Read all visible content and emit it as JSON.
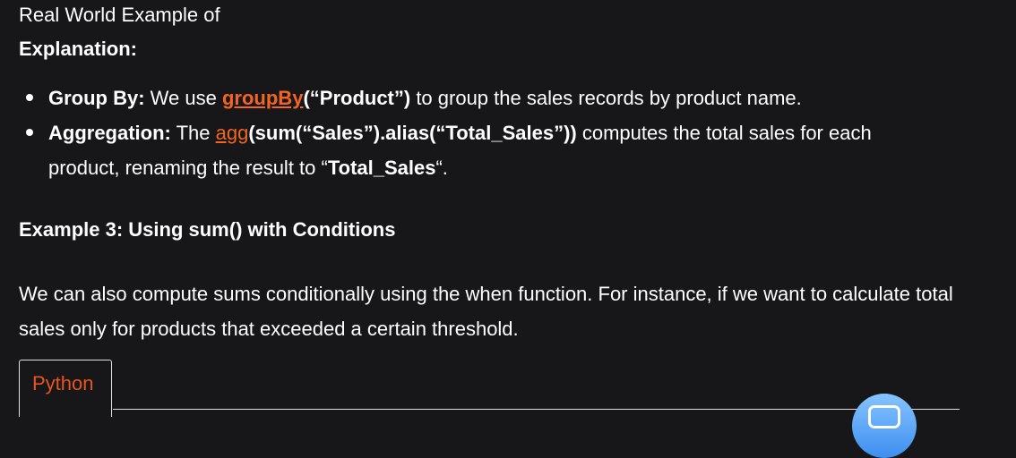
{
  "intro_line": "Real World Example of",
  "explanation_heading": "Explanation:",
  "bullets": [
    {
      "label": "Group By:",
      "text1": " We use ",
      "link": "groupBy",
      "code": "(“Product”)",
      "text2": " to group the sales records by product name."
    },
    {
      "label": "Aggregation:",
      "text1": " The ",
      "link": "agg",
      "code": "(sum(“Sales”).alias(“Total_Sales”))",
      "text2": " computes the total sales for each product, renaming the result to “",
      "code2": "Total_Sales",
      "text3": "“."
    }
  ],
  "example_heading": "Example 3: Using sum() with Conditions",
  "paragraph": "We can also compute sums conditionally using the when function. For instance, if we want to calculate total sales only for products that exceeded a certain threshold.",
  "code_tab_label": "Python",
  "colors": {
    "background": "#17171a",
    "link": "#f26522",
    "tab_text": "#e8541e",
    "fab": "#5aa7ff"
  },
  "icons": {
    "fab": "chat-icon"
  }
}
